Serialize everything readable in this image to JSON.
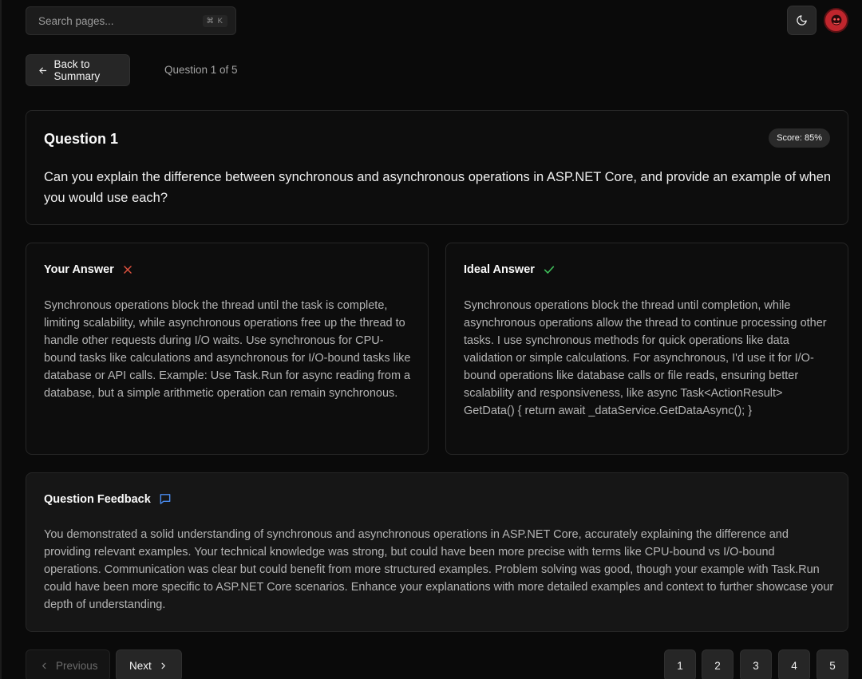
{
  "header": {
    "search_placeholder": "Search pages...",
    "search_shortcut": "⌘ K",
    "theme_icon": "moon-icon",
    "avatar_icon": "user-avatar-icon"
  },
  "nav": {
    "back_label": "Back to Summary",
    "progress": "Question 1 of 5"
  },
  "question": {
    "title": "Question 1",
    "score": "Score: 85%",
    "text": "Can you explain the difference between synchronous and asynchronous operations in ASP.NET Core, and provide an example of when you would use each?"
  },
  "your_answer": {
    "title": "Your Answer",
    "status_icon": "x-icon",
    "status_color": "#e0523f",
    "text": "Synchronous operations block the thread until the task is complete, limiting scalability, while asynchronous operations free up the thread to handle other requests during I/O waits. Use synchronous for CPU-bound tasks like calculations and asynchronous for I/O-bound tasks like database or API calls. Example: Use Task.Run for async reading from a database, but a simple arithmetic operation can remain synchronous."
  },
  "ideal_answer": {
    "title": "Ideal Answer",
    "status_icon": "check-icon",
    "status_color": "#3fbf5a",
    "text": "Synchronous operations block the thread until completion, while asynchronous operations allow the thread to continue processing other tasks. I use synchronous methods for quick operations like data validation or simple calculations. For asynchronous, I'd use it for I/O-bound operations like database calls or file reads, ensuring better scalability and responsiveness, like async Task<ActionResult> GetData() { return await _dataService.GetDataAsync(); }"
  },
  "feedback": {
    "title": "Question Feedback",
    "icon": "message-icon",
    "icon_color": "#4a8cf0",
    "text": "You demonstrated a solid understanding of synchronous and asynchronous operations in ASP.NET Core, accurately explaining the difference and providing relevant examples. Your technical knowledge was strong, but could have been more precise with terms like CPU-bound vs I/O-bound operations. Communication was clear but could benefit from more structured examples. Problem solving was good, though your example with Task.Run could have been more specific to ASP.NET Core scenarios. Enhance your explanations with more detailed examples and context to further showcase your depth of understanding."
  },
  "pagination": {
    "previous_label": "Previous",
    "next_label": "Next",
    "pages": [
      "1",
      "2",
      "3",
      "4",
      "5"
    ]
  }
}
